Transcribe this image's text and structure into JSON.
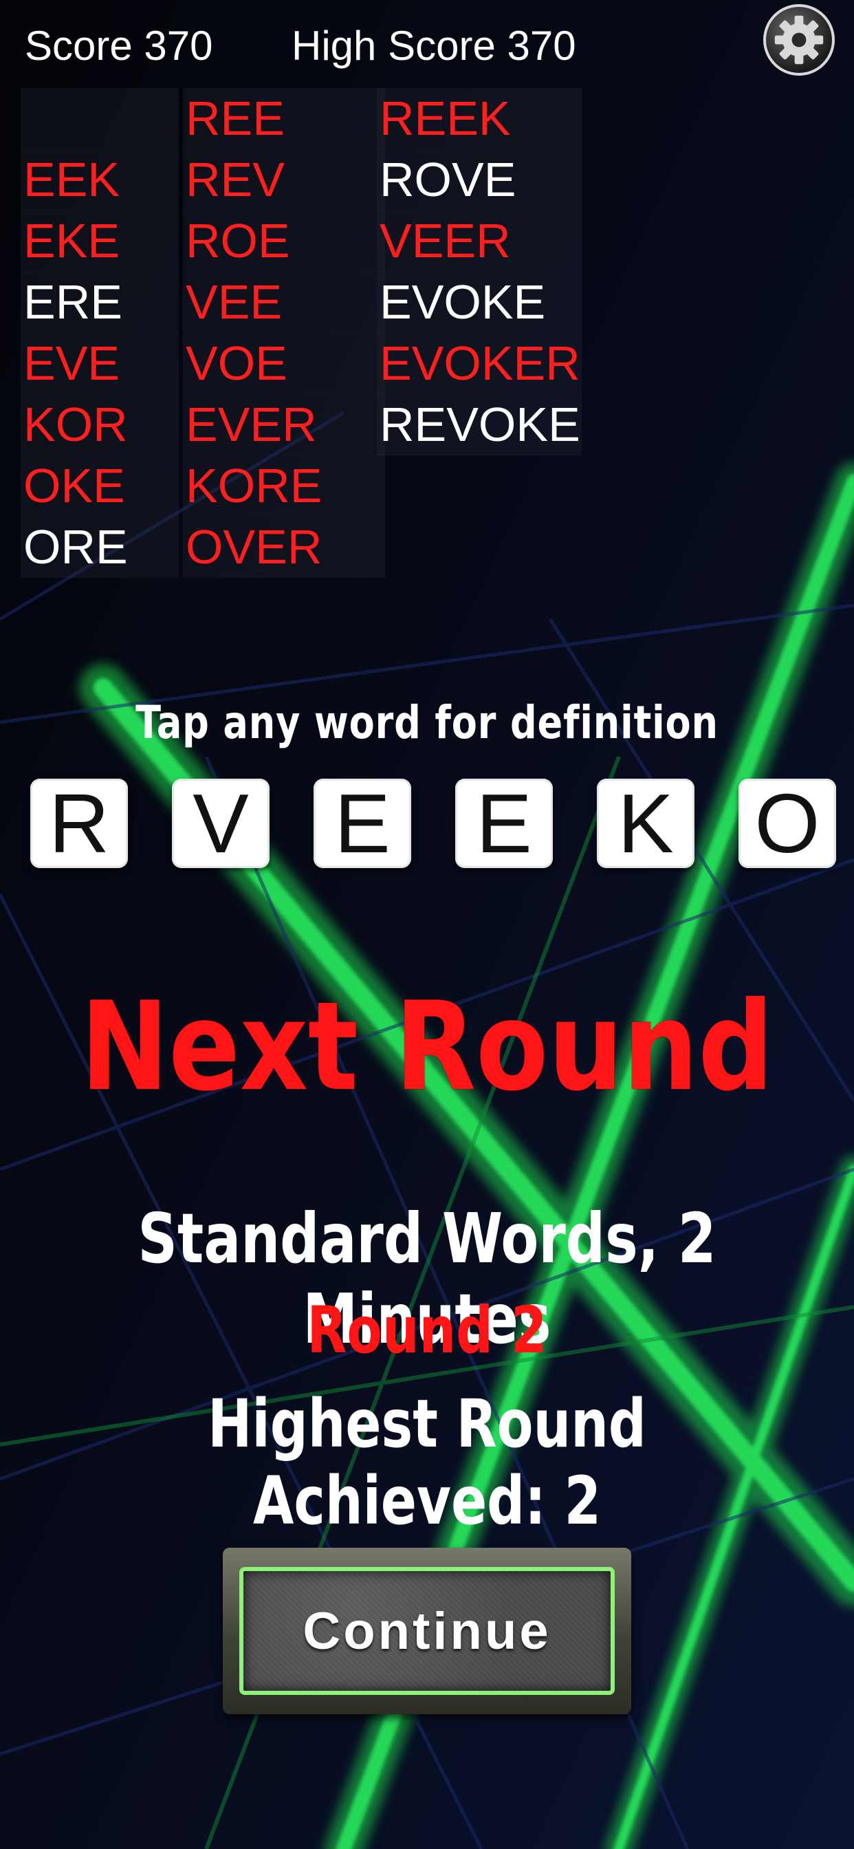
{
  "header": {
    "score": "Score 370",
    "high_score": "High Score 370",
    "settings_icon": "gear-icon"
  },
  "words": {
    "columns": [
      [
        {
          "text": "",
          "found": true
        },
        {
          "text": "EEK",
          "found": true
        },
        {
          "text": "EKE",
          "found": true
        },
        {
          "text": "ERE",
          "found": false
        },
        {
          "text": "EVE",
          "found": true
        },
        {
          "text": "KOR",
          "found": true
        },
        {
          "text": "OKE",
          "found": true
        },
        {
          "text": "ORE",
          "found": false
        }
      ],
      [
        {
          "text": "REE",
          "found": true
        },
        {
          "text": "REV",
          "found": true
        },
        {
          "text": "ROE",
          "found": true
        },
        {
          "text": "VEE",
          "found": true
        },
        {
          "text": "VOE",
          "found": true
        },
        {
          "text": "EVER",
          "found": true
        },
        {
          "text": "KORE",
          "found": true
        },
        {
          "text": "OVER",
          "found": true
        }
      ],
      [
        {
          "text": "REEK",
          "found": true
        },
        {
          "text": "ROVE",
          "found": false
        },
        {
          "text": "VEER",
          "found": true
        },
        {
          "text": "EVOKE",
          "found": false
        },
        {
          "text": "EVOKER",
          "found": true
        },
        {
          "text": "REVOKE",
          "found": false
        }
      ]
    ],
    "found_color": "#ff1f1f",
    "missed_color": "#ffffff"
  },
  "hint": "Tap any word for definition",
  "tiles": [
    "R",
    "V",
    "E",
    "E",
    "K",
    "O"
  ],
  "next_round": {
    "title": "Next Round",
    "mode": "Standard Words, 2 Minutes",
    "round": "Round 2",
    "highest": "Highest Round Achieved: 2"
  },
  "continue_label": "Continue",
  "colors": {
    "accent_red": "#ff1515",
    "background": "#05070f",
    "glow_green": "#1ed14b"
  }
}
